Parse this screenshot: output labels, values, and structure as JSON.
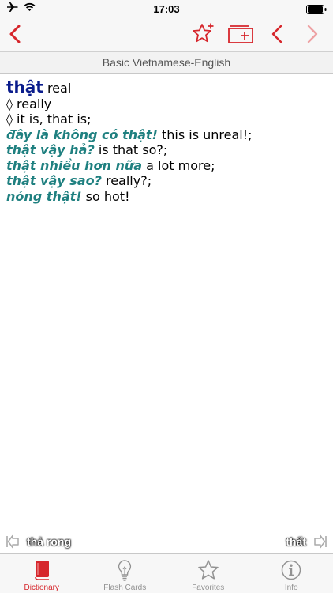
{
  "status": {
    "time": "17:03"
  },
  "header": {
    "subtitle": "Basic Vietnamese-English"
  },
  "entry": {
    "headword": "thật",
    "gloss": " real",
    "senses": [
      "◊ really",
      "◊ it is, that is;"
    ],
    "examples": [
      {
        "vi": "đây là không có thật!",
        "en": " this is unreal!;"
      },
      {
        "vi": "thật vậy hả?",
        "en": " is that so?;"
      },
      {
        "vi": "thật nhiều hơn nữa",
        "en": " a lot more;"
      },
      {
        "vi": "thật vậy sao?",
        "en": " really?;"
      },
      {
        "vi": "nóng thật!",
        "en": " so hot!"
      }
    ]
  },
  "navigation": {
    "previous_word": "thả rong",
    "next_word": "thất"
  },
  "tabs": [
    {
      "label": "Dictionary",
      "icon": "book-icon",
      "active": true
    },
    {
      "label": "Flash Cards",
      "icon": "lightbulb-icon",
      "active": false
    },
    {
      "label": "Favorites",
      "icon": "star-icon",
      "active": false
    },
    {
      "label": "Info",
      "icon": "info-icon",
      "active": false
    }
  ],
  "colors": {
    "accent": "#d6262c",
    "headword": "#0a1c8c",
    "example": "#1f8080",
    "tab_inactive": "#929292"
  }
}
